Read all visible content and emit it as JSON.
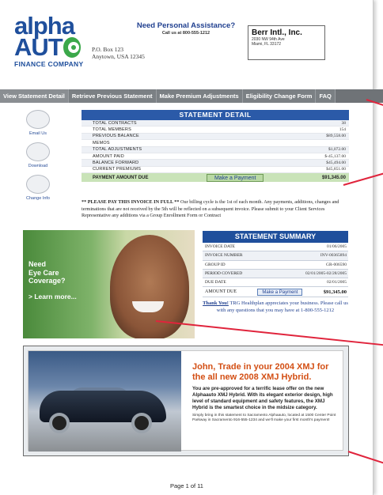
{
  "logo": {
    "line1": "alpha",
    "line2": "AUT",
    "sub": "FINANCE COMPANY"
  },
  "address": {
    "line1": "P.O. Box 123",
    "line2": "Anytown, USA 12345"
  },
  "assistance": {
    "title": "Need Personal Assistance?",
    "subtitle": "Call us at 800-555-1212"
  },
  "bill_to": {
    "name": "Berr Intl., Inc.",
    "line1": "2030 NW 94th Ave",
    "line2": "Miami, FL 33172"
  },
  "nav": [
    "View Statement Detail",
    "Retrieve Previous Statement",
    "Make Premium Adjustments",
    "Eligibility Change Form",
    "FAQ"
  ],
  "side_icons": [
    {
      "icon": "email-icon",
      "label": "Email Us"
    },
    {
      "icon": "download-icon",
      "label": "Download"
    },
    {
      "icon": "change-info-icon",
      "label": "Change Info"
    }
  ],
  "detail": {
    "title": "STATEMENT DETAIL",
    "rows": [
      {
        "label": "TOTAL CONTRACTS",
        "value": "38"
      },
      {
        "label": "TOTAL MEMBERS",
        "value": "154"
      },
      {
        "label": "PREVIOUS BALANCE",
        "value": "$89,558.00"
      },
      {
        "label": "MEMOS",
        "value": ""
      },
      {
        "label": "TOTAL ADJUSTMENTS",
        "value": "$1,072.00"
      },
      {
        "label": "AMOUNT PAID",
        "value": "$-45,137.00"
      },
      {
        "label": "BALANCE FORWARD",
        "value": "$45,494.00"
      },
      {
        "label": "CURRENT PREMIUMS",
        "value": "$45,851.00"
      }
    ],
    "pay_label": "PAYMENT AMOUNT DUE",
    "pay_button": "Make a Payment",
    "pay_value": "$91,345.00"
  },
  "notice": {
    "bold": "** PLEASE PAY THIS INVOICE IN FULL **",
    "text": " Our billing cycle is the 1st of each month. Any payments, additions, changes and terminations that are not received by the 5th will be reflected on a subsequent invoice. Please submit to your Client Services Representative any additions via a Group Enrollment Form or Contract"
  },
  "eyecare": {
    "line1": "Need",
    "line2": "Eye Care",
    "line3": "Coverage?",
    "learn": "> Learn more..."
  },
  "summary": {
    "title": "STATEMENT SUMMARY",
    "rows": [
      {
        "label": "INVOICE DATE",
        "value": "01/06/2005"
      },
      {
        "label": "INVOICE NUMBER",
        "value": "INV-00365894"
      },
      {
        "label": "GROUP ID",
        "value": "GR-006590"
      },
      {
        "label": "PERIOD COVERED",
        "value": "02/01/2005-02/28/2005"
      },
      {
        "label": "DUE DATE",
        "value": "02/01/2005"
      }
    ],
    "amount_label": "AMOUNT DUE",
    "amount_button": "Make a Payment",
    "amount_value": "$91,345.00",
    "thanks": "Thank You!",
    "thanks_rest": " TRG Healthplan appreciates your business. Please call us with any questions that you may have at 1-800-555-1212"
  },
  "car_ad": {
    "title": "John, Trade in your 2004 XMJ for the all new 2008 XMJ Hybrid.",
    "body": "You are pre-approved for a terrific lease offer on the new Alphaauto XMJ Hybrid. With its elegant exterior design, high level of standard equipment and safety features, the XMJ Hybrid is the smartest choice in the midsize category.",
    "small": "Simply bring in this statement to Sacramento Alphaauto, located at 1500 Center Point Parkway in Sacramento 916-555-1234 and we'll make your first month's payment!"
  },
  "page": "Page 1 of 11",
  "colors": {
    "brand_blue": "#1f4f9c",
    "logo_green": "#3ba84a",
    "nav_gray": "#7b8084",
    "callout_red": "#e0243c",
    "ad_orange": "#d34f14"
  }
}
